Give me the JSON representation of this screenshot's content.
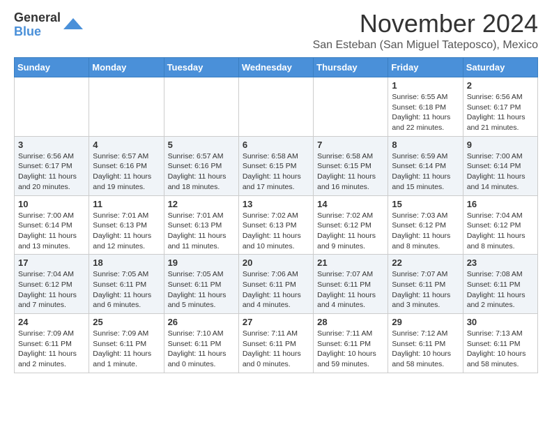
{
  "logo": {
    "general": "General",
    "blue": "Blue"
  },
  "header": {
    "month": "November 2024",
    "location": "San Esteban (San Miguel Tateposco), Mexico"
  },
  "weekdays": [
    "Sunday",
    "Monday",
    "Tuesday",
    "Wednesday",
    "Thursday",
    "Friday",
    "Saturday"
  ],
  "weeks": [
    [
      {
        "day": "",
        "info": ""
      },
      {
        "day": "",
        "info": ""
      },
      {
        "day": "",
        "info": ""
      },
      {
        "day": "",
        "info": ""
      },
      {
        "day": "",
        "info": ""
      },
      {
        "day": "1",
        "info": "Sunrise: 6:55 AM\nSunset: 6:18 PM\nDaylight: 11 hours and 22 minutes."
      },
      {
        "day": "2",
        "info": "Sunrise: 6:56 AM\nSunset: 6:17 PM\nDaylight: 11 hours and 21 minutes."
      }
    ],
    [
      {
        "day": "3",
        "info": "Sunrise: 6:56 AM\nSunset: 6:17 PM\nDaylight: 11 hours and 20 minutes."
      },
      {
        "day": "4",
        "info": "Sunrise: 6:57 AM\nSunset: 6:16 PM\nDaylight: 11 hours and 19 minutes."
      },
      {
        "day": "5",
        "info": "Sunrise: 6:57 AM\nSunset: 6:16 PM\nDaylight: 11 hours and 18 minutes."
      },
      {
        "day": "6",
        "info": "Sunrise: 6:58 AM\nSunset: 6:15 PM\nDaylight: 11 hours and 17 minutes."
      },
      {
        "day": "7",
        "info": "Sunrise: 6:58 AM\nSunset: 6:15 PM\nDaylight: 11 hours and 16 minutes."
      },
      {
        "day": "8",
        "info": "Sunrise: 6:59 AM\nSunset: 6:14 PM\nDaylight: 11 hours and 15 minutes."
      },
      {
        "day": "9",
        "info": "Sunrise: 7:00 AM\nSunset: 6:14 PM\nDaylight: 11 hours and 14 minutes."
      }
    ],
    [
      {
        "day": "10",
        "info": "Sunrise: 7:00 AM\nSunset: 6:14 PM\nDaylight: 11 hours and 13 minutes."
      },
      {
        "day": "11",
        "info": "Sunrise: 7:01 AM\nSunset: 6:13 PM\nDaylight: 11 hours and 12 minutes."
      },
      {
        "day": "12",
        "info": "Sunrise: 7:01 AM\nSunset: 6:13 PM\nDaylight: 11 hours and 11 minutes."
      },
      {
        "day": "13",
        "info": "Sunrise: 7:02 AM\nSunset: 6:13 PM\nDaylight: 11 hours and 10 minutes."
      },
      {
        "day": "14",
        "info": "Sunrise: 7:02 AM\nSunset: 6:12 PM\nDaylight: 11 hours and 9 minutes."
      },
      {
        "day": "15",
        "info": "Sunrise: 7:03 AM\nSunset: 6:12 PM\nDaylight: 11 hours and 8 minutes."
      },
      {
        "day": "16",
        "info": "Sunrise: 7:04 AM\nSunset: 6:12 PM\nDaylight: 11 hours and 8 minutes."
      }
    ],
    [
      {
        "day": "17",
        "info": "Sunrise: 7:04 AM\nSunset: 6:12 PM\nDaylight: 11 hours and 7 minutes."
      },
      {
        "day": "18",
        "info": "Sunrise: 7:05 AM\nSunset: 6:11 PM\nDaylight: 11 hours and 6 minutes."
      },
      {
        "day": "19",
        "info": "Sunrise: 7:05 AM\nSunset: 6:11 PM\nDaylight: 11 hours and 5 minutes."
      },
      {
        "day": "20",
        "info": "Sunrise: 7:06 AM\nSunset: 6:11 PM\nDaylight: 11 hours and 4 minutes."
      },
      {
        "day": "21",
        "info": "Sunrise: 7:07 AM\nSunset: 6:11 PM\nDaylight: 11 hours and 4 minutes."
      },
      {
        "day": "22",
        "info": "Sunrise: 7:07 AM\nSunset: 6:11 PM\nDaylight: 11 hours and 3 minutes."
      },
      {
        "day": "23",
        "info": "Sunrise: 7:08 AM\nSunset: 6:11 PM\nDaylight: 11 hours and 2 minutes."
      }
    ],
    [
      {
        "day": "24",
        "info": "Sunrise: 7:09 AM\nSunset: 6:11 PM\nDaylight: 11 hours and 2 minutes."
      },
      {
        "day": "25",
        "info": "Sunrise: 7:09 AM\nSunset: 6:11 PM\nDaylight: 11 hours and 1 minute."
      },
      {
        "day": "26",
        "info": "Sunrise: 7:10 AM\nSunset: 6:11 PM\nDaylight: 11 hours and 0 minutes."
      },
      {
        "day": "27",
        "info": "Sunrise: 7:11 AM\nSunset: 6:11 PM\nDaylight: 11 hours and 0 minutes."
      },
      {
        "day": "28",
        "info": "Sunrise: 7:11 AM\nSunset: 6:11 PM\nDaylight: 10 hours and 59 minutes."
      },
      {
        "day": "29",
        "info": "Sunrise: 7:12 AM\nSunset: 6:11 PM\nDaylight: 10 hours and 58 minutes."
      },
      {
        "day": "30",
        "info": "Sunrise: 7:13 AM\nSunset: 6:11 PM\nDaylight: 10 hours and 58 minutes."
      }
    ]
  ]
}
